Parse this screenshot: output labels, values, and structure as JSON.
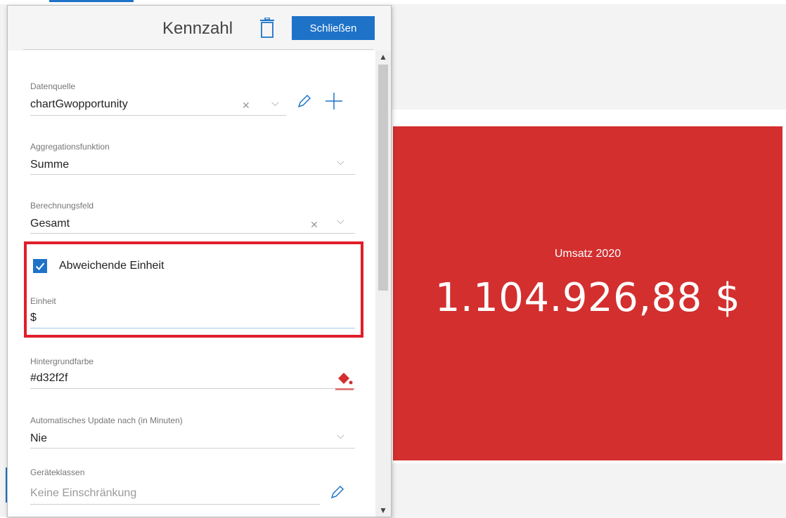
{
  "kpi": {
    "subtitle": "Umsatz 2020",
    "value": "1.104.926,88 $",
    "background": "#d32f2f"
  },
  "panel": {
    "title": "Kennzahl",
    "close_label": "Schließen",
    "accent": "#1e73c8",
    "fields": {
      "datenquelle": {
        "label": "Datenquelle",
        "value": "chartGwopportunity"
      },
      "aggregation": {
        "label": "Aggregationsfunktion",
        "value": "Summe"
      },
      "berechnung": {
        "label": "Berechnungsfeld",
        "value": "Gesamt"
      },
      "abweichende": {
        "label": "Abweichende Einheit",
        "checked": true
      },
      "einheit": {
        "label": "Einheit",
        "value": "$"
      },
      "hintergrund": {
        "label": "Hintergrundfarbe",
        "value": "#d32f2f"
      },
      "update": {
        "label": "Automatisches Update nach (in Minuten)",
        "value": "Nie"
      },
      "geraete": {
        "label": "Geräteklassen",
        "placeholder": "Keine Einschränkung"
      }
    }
  },
  "icons": {
    "clear": "✕",
    "chevron": "⌵",
    "scroll_up": "▲",
    "scroll_down": "▼"
  },
  "highlight_color": "#e01e2a"
}
